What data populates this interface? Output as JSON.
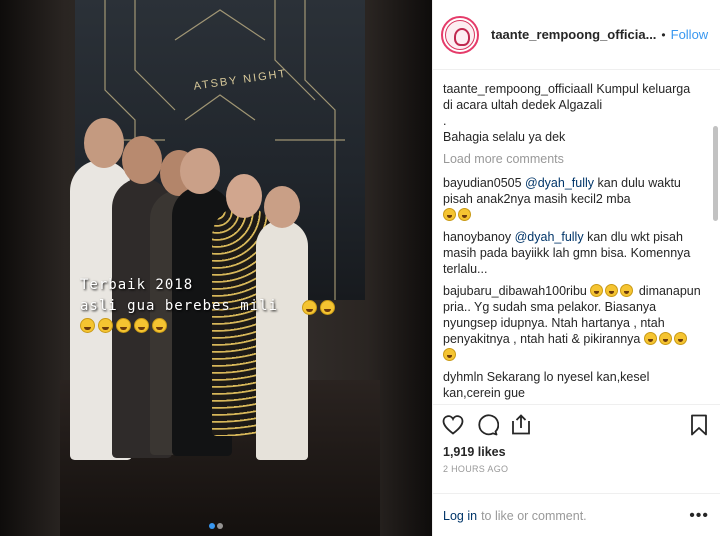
{
  "post": {
    "username": "taante_rempoong_officia...",
    "separator": "•",
    "follow_label": "Follow",
    "caption": {
      "user": "taante_rempoong_officia",
      "text": "all Kumpul keluarga di acara ultah dedek Algazali",
      "line_dot": ".",
      "line_last": "Bahagia selalu ya dek"
    },
    "load_more": "Load more comments",
    "comments": [
      {
        "user": "bayudian0505",
        "mention": "@dyah_fully",
        "text": " kan dulu waktu pisah anak2nya masih kecil2 mba",
        "emoji_count": 2
      },
      {
        "user": "hanoybanoy",
        "mention": "@dyah_fully",
        "text": " kan dlu wkt pisah masih pada bayiikk lah gmn bisa. Komennya terlalu...",
        "emoji_count": 0
      },
      {
        "user": "bajubaru_dibawah100ribu",
        "mention": "",
        "text": " ",
        "text_after": "dimanapun pria.. Yg sudah sma pelakor. Biasanya nyungsep idupnya. Ntah hartanya , ntah penyakitnya , ntah hati & pikirannya ",
        "emoji_lead": 3,
        "emoji_count": 4
      },
      {
        "user": "dyhmln",
        "mention": "",
        "text": " Sekarang lo nyesel kan,kesel kan,cerein gue",
        "emoji_count": 0
      }
    ],
    "likes": "1,919 likes",
    "time": "2 HOURS AGO",
    "login_link": "Log in",
    "login_text": "to like or comment.",
    "more_icon": "•••"
  },
  "media": {
    "overlay_line1": "Terbaik 2018",
    "overlay_line2": "asli gua berebes mili",
    "backdrop_text": "ATSBY NIGHT",
    "carousel_dots": 2,
    "carousel_active": 0
  },
  "icons": [
    "heart-icon",
    "comment-icon",
    "share-icon",
    "bookmark-icon"
  ],
  "colors": {
    "follow": "#3897f0",
    "link": "#003569",
    "muted": "#999999",
    "avatar_ring": "#e53b6a"
  }
}
